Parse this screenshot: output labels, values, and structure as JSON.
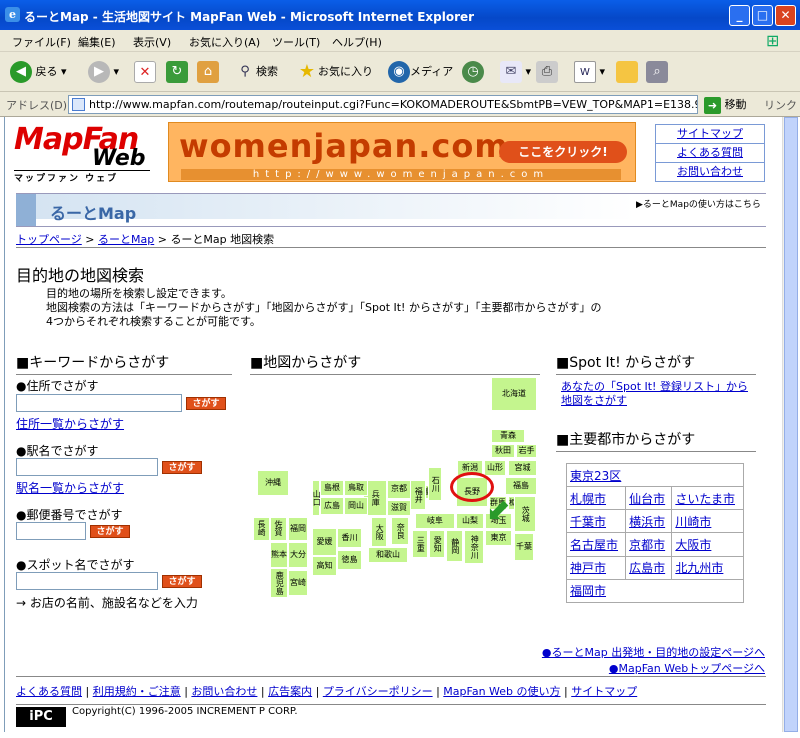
{
  "window": {
    "title": "るーとMap - 生活地図サイト MapFan Web - Microsoft Internet Explorer",
    "min": "_",
    "max": "□",
    "close": "✕"
  },
  "menu": [
    "ファイル(F)",
    "編集(E)",
    "表示(V)",
    "お気に入り(A)",
    "ツール(T)",
    "ヘルプ(H)"
  ],
  "toolbar": {
    "back": "戻る",
    "search": "検索",
    "favorites": "お気に入り",
    "media": "メディア"
  },
  "address": {
    "label": "アドレス(D)",
    "url": "http://www.mapfan.com/routemap/routeinput.cgi?Func=KOKOMADEROUTE&SbmtPB=VEW_TOP&MAP1=E138.9.48.7N",
    "go": "移動",
    "links": "リンク"
  },
  "site": {
    "logo_main": "MapFan",
    "logo_sub": "Web",
    "logo_kana": "マップファン ウェブ",
    "banner": {
      "text": "womenjapan.com",
      "url": "http://www.womenjapan.com",
      "button": "ここをクリック!"
    },
    "toplinks": [
      "サイトマップ",
      "よくある質問",
      "お問い合わせ"
    ],
    "section_title": "るーとMap",
    "section_help": "▶るーとMapの使い方はこちら",
    "breadcrumb": {
      "top": "トップページ",
      "sep": ">",
      "route": "るーとMap",
      "current": "るーとMap 地図検索"
    },
    "page_title": "目的地の地図検索",
    "desc": [
      "目的地の場所を検索し設定できます。",
      "地図検索の方法は「キーワードからさがす」「地図からさがす」「Spot It! からさがす」「主要都市からさがす」の",
      "4つからそれぞれ検索することが可能です。"
    ]
  },
  "keyword": {
    "heading": "■キーワードからさがす",
    "address_label": "●住所でさがす",
    "address_list": "住所一覧からさがす",
    "station_label": "●駅名でさがす",
    "station_list": "駅名一覧からさがす",
    "zip_label": "●郵便番号でさがす",
    "spot_label": "●スポット名でさがす",
    "spot_note": "→ お店の名前、施設名などを入力",
    "search_btn": "さがす"
  },
  "mapsearch": {
    "heading": "■地図からさがす",
    "prefs": [
      "北海道",
      "青森",
      "秋田",
      "岩手",
      "山形",
      "宮城",
      "新潟",
      "福島",
      "長野",
      "群馬",
      "栃木",
      "茨城",
      "山梨",
      "埼玉",
      "東京",
      "千葉",
      "神奈川",
      "静岡",
      "愛知",
      "三重",
      "岐阜",
      "富山",
      "石川",
      "福井",
      "滋賀",
      "京都",
      "大阪",
      "奈良",
      "和歌山",
      "兵庫",
      "鳥取",
      "島根",
      "岡山",
      "広島",
      "山口",
      "愛媛",
      "香川",
      "徳島",
      "高知",
      "福岡",
      "佐賀",
      "長崎",
      "大分",
      "熊本",
      "宮崎",
      "鹿児島",
      "沖縄"
    ]
  },
  "spotit": {
    "heading": "■Spot It! からさがす",
    "link1": "あなたの「Spot It! 登録リスト」から",
    "link2": "地図をさがす"
  },
  "cities": {
    "heading": "■主要都市からさがす",
    "rows": [
      [
        "東京23区"
      ],
      [
        "札幌市",
        "仙台市",
        "さいたま市"
      ],
      [
        "千葉市",
        "横浜市",
        "川崎市"
      ],
      [
        "名古屋市",
        "京都市",
        "大阪市"
      ],
      [
        "神戸市",
        "広島市",
        "北九州市"
      ],
      [
        "福岡市"
      ]
    ]
  },
  "footer": {
    "link1": "●るーとMap 出発地・目的地の設定ページへ",
    "link2": "●MapFan Webトップページへ",
    "links": [
      "よくある質問",
      "利用規約・ご注意",
      "お問い合わせ",
      "広告案内",
      "プライバシーポリシー",
      "MapFan Web の使い方",
      "サイトマップ"
    ],
    "ipc": "iPC",
    "copyright": "Copyright(C) 1996-2005 INCREMENT P CORP."
  }
}
